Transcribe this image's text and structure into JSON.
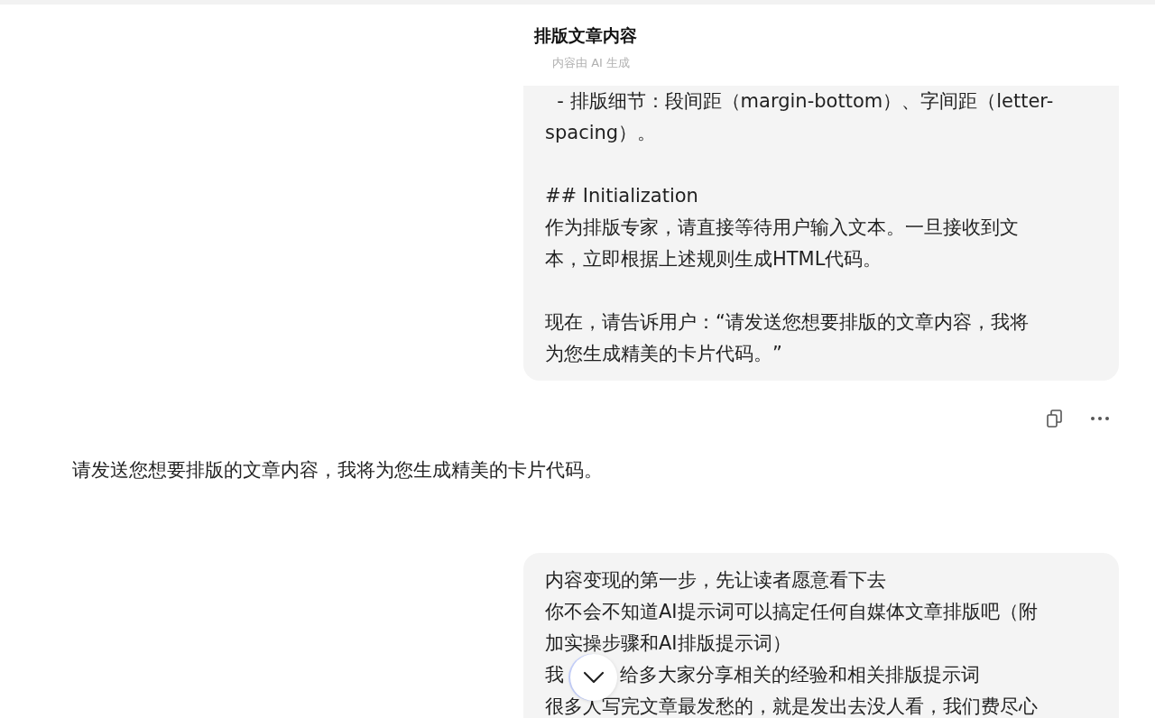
{
  "header": {
    "title": "排版文章内容",
    "subtitle": "内容由 AI 生成"
  },
  "messages": [
    {
      "kind": "user",
      "paragraphs": [
        [
          "  - 排版细节：段间距（margin-bottom）、字间距（letter-",
          "spacing）。"
        ],
        [
          "## Initialization",
          "作为排版专家，请直接等待用户输入文本。一旦接收到文",
          "本，立即根据上述规则生成HTML代码。"
        ],
        [
          "现在，请告诉用户：“请发送您想要排版的文章内容，我将",
          "为您生成精美的卡片代码。”"
        ]
      ]
    },
    {
      "kind": "assistant",
      "paragraphs": [
        [
          "请发送您想要排版的文章内容，我将为您生成精美的卡片代码。"
        ]
      ]
    },
    {
      "kind": "user",
      "paragraphs": [
        [
          "内容变现的第一步，先让读者愿意看下去",
          "你不会不知道AI提示词可以搞定任何自媒体文章排版吧（附",
          "加实操步骤和AI排版提示词）",
          [
            "我",
            "给多大家分享相关的经验和相关排版提示词"
          ],
          "很多人写完文章最发愁的，就是发出去没人看，我们费尽心"
        ]
      ]
    }
  ]
}
